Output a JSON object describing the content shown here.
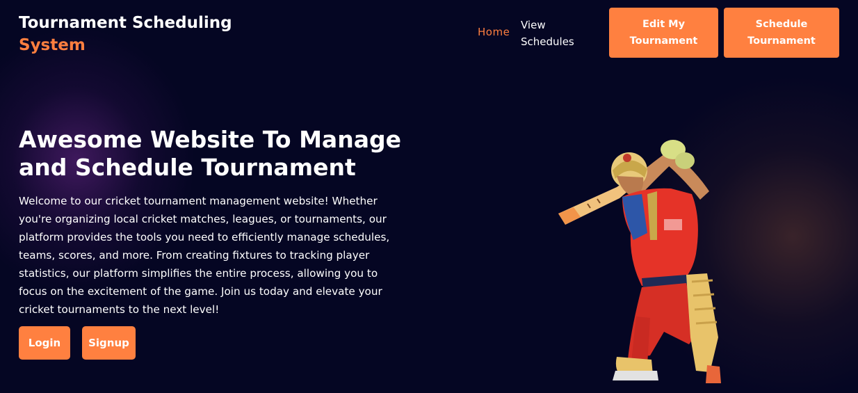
{
  "header": {
    "brand_line1": "Tournament Scheduling",
    "brand_line2": "System",
    "nav": {
      "home": "Home",
      "view_schedules": "View Schedules"
    },
    "buttons": {
      "edit_tournament": "Edit My Tournament",
      "schedule_tournament": "Schedule Tournament"
    }
  },
  "hero": {
    "title": "Awesome Website To Manage and Schedule Tournament",
    "description": "Welcome to our cricket tournament management website! Whether you're organizing local cricket matches, leagues, or tournaments, our platform provides the tools you need to efficiently manage schedules, teams, scores, and more. From creating fixtures to tracking player statistics, our platform simplifies the entire process, allowing you to focus on the excitement of the game. Join us today and elevate your cricket tournaments to the next level!",
    "login_label": "Login",
    "signup_label": "Signup",
    "image": "cricket-batsman-illustration"
  },
  "colors": {
    "background": "#050623",
    "accent": "#ff7f3f",
    "button": "#ff8040",
    "text": "#ffffff"
  }
}
